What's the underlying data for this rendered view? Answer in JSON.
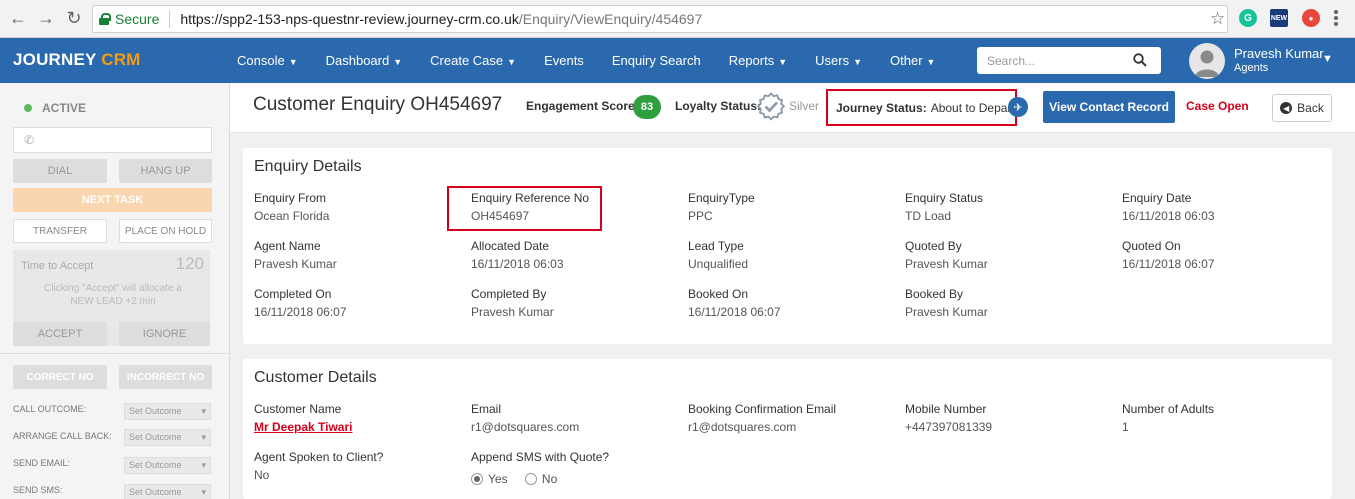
{
  "browser": {
    "secure_label": "Secure",
    "url_main": "https://spp2-153-nps-questnr-review.journey-crm.co.uk",
    "url_path": "/Enquiry/ViewEnquiry/454697",
    "ext_new_label": "NEW"
  },
  "header": {
    "brand_first": "JOURNEY",
    "brand_second": "CRM",
    "nav": [
      "Console",
      "Dashboard",
      "Create Case",
      "Events",
      "Enquiry Search",
      "Reports",
      "Users",
      "Other"
    ],
    "search_placeholder": "Search...",
    "user_name": "Pravesh Kumar",
    "user_role": "Agents"
  },
  "leftpanel": {
    "status": "ACTIVE",
    "dial": "DIAL",
    "hang_up": "HANG UP",
    "next_task": "NEXT TASK",
    "transfer": "TRANSFER",
    "place_on_hold": "PLACE ON HOLD",
    "time_to_accept": "Time to Accept",
    "countdown": "120",
    "accept_note": "Clicking \"Accept\" will allocate a NEW LEAD +2 min",
    "accept": "ACCEPT",
    "ignore": "IGNORE",
    "correct_no": "CORRECT NO",
    "incorrect_no": "INCORRECT NO",
    "rows": [
      {
        "label": "CALL OUTCOME:",
        "value": "Set Outcome"
      },
      {
        "label": "ARRANGE CALL BACK:",
        "value": "Set Outcome"
      },
      {
        "label": "SEND EMAIL:",
        "value": "Set Outcome"
      },
      {
        "label": "SEND SMS:",
        "value": "Set Outcome"
      }
    ]
  },
  "titlebar": {
    "title": "Customer Enquiry OH454697",
    "engagement_label": "Engagement Score:",
    "engagement_score": "83",
    "loyalty_label": "Loyalty Status:",
    "loyalty_value": "Silver",
    "journey_label": "Journey Status:",
    "journey_value": "About to Depart",
    "view_contact": "View Contact Record",
    "case_status": "Case Open",
    "back": "Back"
  },
  "enquiry_details": {
    "title": "Enquiry Details",
    "fields": [
      {
        "label": "Enquiry From",
        "value": "Ocean Florida"
      },
      {
        "label": "Enquiry Reference No",
        "value": "OH454697"
      },
      {
        "label": "EnquiryType",
        "value": "PPC"
      },
      {
        "label": "Enquiry Status",
        "value": "TD Load"
      },
      {
        "label": "Enquiry Date",
        "value": "16/11/2018 06:03"
      },
      {
        "label": "Agent Name",
        "value": "Pravesh Kumar"
      },
      {
        "label": "Allocated Date",
        "value": "16/11/2018 06:03"
      },
      {
        "label": "Lead Type",
        "value": "Unqualified"
      },
      {
        "label": "Quoted By",
        "value": "Pravesh Kumar"
      },
      {
        "label": "Quoted On",
        "value": "16/11/2018 06:07"
      },
      {
        "label": "Completed On",
        "value": "16/11/2018 06:07"
      },
      {
        "label": "Completed By",
        "value": "Pravesh Kumar"
      },
      {
        "label": "Booked On",
        "value": "16/11/2018 06:07"
      },
      {
        "label": "Booked By",
        "value": "Pravesh Kumar"
      }
    ]
  },
  "customer_details": {
    "title": "Customer Details",
    "fields": [
      {
        "label": "Customer Name",
        "value": "Mr Deepak Tiwari"
      },
      {
        "label": "Email",
        "value": "r1@dotsquares.com"
      },
      {
        "label": "Booking Confirmation Email",
        "value": "r1@dotsquares.com"
      },
      {
        "label": "Mobile Number",
        "value": "+447397081339"
      },
      {
        "label": "Number of Adults",
        "value": "1"
      },
      {
        "label": "Agent Spoken to Client?",
        "value": "No"
      }
    ],
    "sms_label": "Append SMS with Quote?",
    "sms_yes": "Yes",
    "sms_no": "No",
    "sms_selected": "Yes"
  }
}
